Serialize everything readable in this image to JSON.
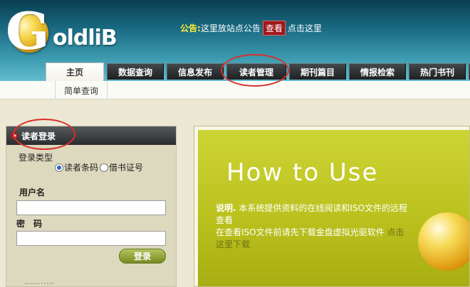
{
  "header": {
    "logo_text": "oldliB",
    "logo_letter": "G",
    "notice_label": "公告:",
    "notice_text": "这里放站点公告",
    "notice_view": "查看",
    "notice_link": "点击这里"
  },
  "tabs": [
    {
      "label": "主页",
      "active": true
    },
    {
      "label": "数据查询"
    },
    {
      "label": "信息发布"
    },
    {
      "label": "读者管理"
    },
    {
      "label": "期刊篇目"
    },
    {
      "label": "情报检索"
    },
    {
      "label": "热门书刊"
    }
  ],
  "subnav": {
    "item": "简单查询"
  },
  "login": {
    "title": "读者登录",
    "type_label": "登录类型",
    "option_barcode": "读者条码",
    "option_card": "借书证号",
    "selected": "读者条码",
    "user_label": "用户名",
    "user_value": "",
    "password_label": "密　码",
    "password_value": "",
    "submit": "登录"
  },
  "banner": {
    "title": "How to Use",
    "desc_bold": "说明.",
    "desc_line1": "本系统提供资料的在线阅读和ISO文件的远程查看",
    "desc_line2": "在查看ISO文件前请先下载金盘虚拟光驱软件",
    "desc_link": "点击这里下载"
  },
  "colors": {
    "header_dark": "#0a3e52",
    "tab_dark": "#1e2022",
    "banner_green": "#bbc21e",
    "annotation_red": "#d9302c",
    "notice_yellow": "#ffee3a"
  }
}
